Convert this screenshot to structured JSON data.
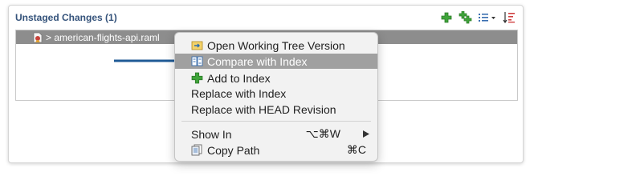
{
  "panel": {
    "title": "Unstaged Changes (1)",
    "toolbar": {
      "buttons": [
        {
          "name": "add-icon"
        },
        {
          "name": "add-all-icon"
        },
        {
          "name": "view-menu-icon"
        },
        {
          "name": "sort-icon"
        }
      ]
    },
    "file": {
      "label": "> american-flights-api.raml",
      "icon": "file-modified-icon"
    }
  },
  "context_menu": {
    "items": [
      {
        "label": "Open Working Tree Version",
        "icon": "open-working-tree-icon"
      },
      {
        "label": "Compare with Index",
        "icon": "compare-icon",
        "selected": true
      },
      {
        "label": "Add to Index",
        "icon": "add-icon"
      },
      {
        "label": "Replace with Index"
      },
      {
        "label": "Replace with HEAD Revision"
      },
      {
        "label": "Show In",
        "shortcut": "⌥⌘W",
        "submenu": true
      },
      {
        "label": "Copy Path",
        "icon": "copy-icon",
        "shortcut": "⌘C"
      }
    ]
  },
  "colors": {
    "title": "#35537b",
    "selection": "#8d8d8d",
    "menu_highlight": "#a0a0a0",
    "arrow": "#1f5a96",
    "add_green": "#3fa43a"
  }
}
